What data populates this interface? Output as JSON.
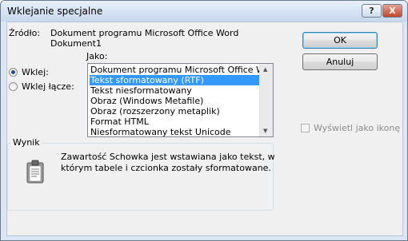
{
  "window": {
    "title": "Wklejanie specjalne"
  },
  "titlebar": {
    "help_glyph": "?",
    "close_glyph": "X"
  },
  "source": {
    "label": "Źródło:",
    "line1": "Dokument programu Microsoft Office Word",
    "line2": "Dokument1"
  },
  "as_label": "Jako:",
  "paste_option": {
    "label": "Wklej:",
    "selected": true
  },
  "paste_link_option": {
    "label": "Wklej łącze:",
    "selected": false
  },
  "formats": [
    "Dokument programu Microsoft Office Word -",
    "Tekst sformatowany (RTF)",
    "Tekst niesformatowany",
    "Obraz (Windows Metafile)",
    "Obraz (rozszerzony metaplik)",
    "Format HTML",
    "Niesformatowany tekst Unicode"
  ],
  "selected_format_index": 1,
  "buttons": {
    "ok": "OK",
    "cancel": "Anuluj"
  },
  "display_as_icon": {
    "label": "Wyświetl jako ikonę",
    "checked": false,
    "enabled": false
  },
  "result": {
    "legend": "Wynik",
    "line1": "Zawartość Schowka jest wstawiana jako tekst, w",
    "line2": "którym tabele i czcionka zostały sformatowane."
  },
  "icons": [
    "help-icon",
    "close-icon",
    "clipboard-icon"
  ]
}
